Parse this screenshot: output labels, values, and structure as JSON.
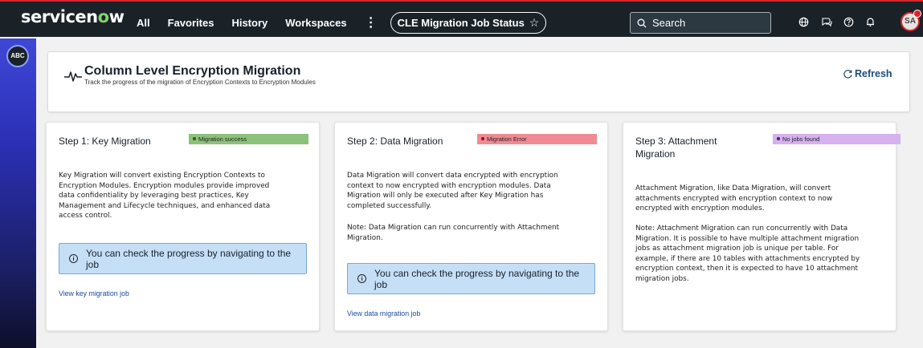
{
  "topbar": {
    "logo_pre": "servicen",
    "logo_o": "o",
    "logo_post": "w",
    "nav": [
      "All",
      "Favorites",
      "History",
      "Workspaces"
    ],
    "more": "⋮",
    "pill_label": "CLE Migration Job Status",
    "pill_star": "☆",
    "search_label": "Search",
    "avatar_initials": "SA"
  },
  "rail": {
    "badge": "ABC"
  },
  "header": {
    "title": "Column Level Encryption Migration",
    "subtitle": "Track the progress of the migration of Encryption Contexts to Encryption Modules",
    "refresh_label": "Refresh"
  },
  "cards": [
    {
      "title": "Step 1: Key Migration",
      "badge": "Migration success",
      "badge_color": "#8cc17a",
      "badge_dot": "#2d5a1e",
      "description": [
        "Key Migration will convert existing Encryption Contexts to",
        "Encryption Modules. Encryption modules provide improved",
        "data confidentiality by leveraging best practices, Key",
        "Management and Lifecycle techniques, and enhanced data",
        "access control."
      ],
      "info": "You can check the progress by navigating to the job",
      "link": "View key migration job"
    },
    {
      "title": "Step 2: Data Migration",
      "badge": "Migration Error",
      "badge_color": "#ef8a93",
      "badge_dot": "#8a1820",
      "description": [
        "Data Migration will convert data encrypted with encryption",
        "context to now encrypted with encryption modules. Data",
        "Migration will only be executed after Key Migration has",
        "completed successfully."
      ],
      "note": [
        "Note: Data Migration can run concurrently with Attachment",
        "Migration."
      ],
      "info": "You can check the progress by navigating to the job",
      "link": "View data migration job"
    },
    {
      "title_lines": [
        "Step 3: Attachment",
        "Migration"
      ],
      "badge": "No jobs found",
      "badge_color": "#d7b0ef",
      "badge_dot": "#4b1d6b",
      "description": [
        "Attachment Migration, like Data Migration, will convert",
        "attachments encrypted with encryption context to now",
        "encrypted with encryption modules."
      ],
      "note": [
        "Note: Attachment Migration can run concurrently with Data",
        "Migration. It is possible to have multiple attachment migration",
        "jobs as attachment migration job is unique per table. For",
        "example, if there are 10 tables with attachments encrypted by",
        "encryption context, then it is expected to have 10 attachment",
        "migration jobs."
      ]
    }
  ]
}
